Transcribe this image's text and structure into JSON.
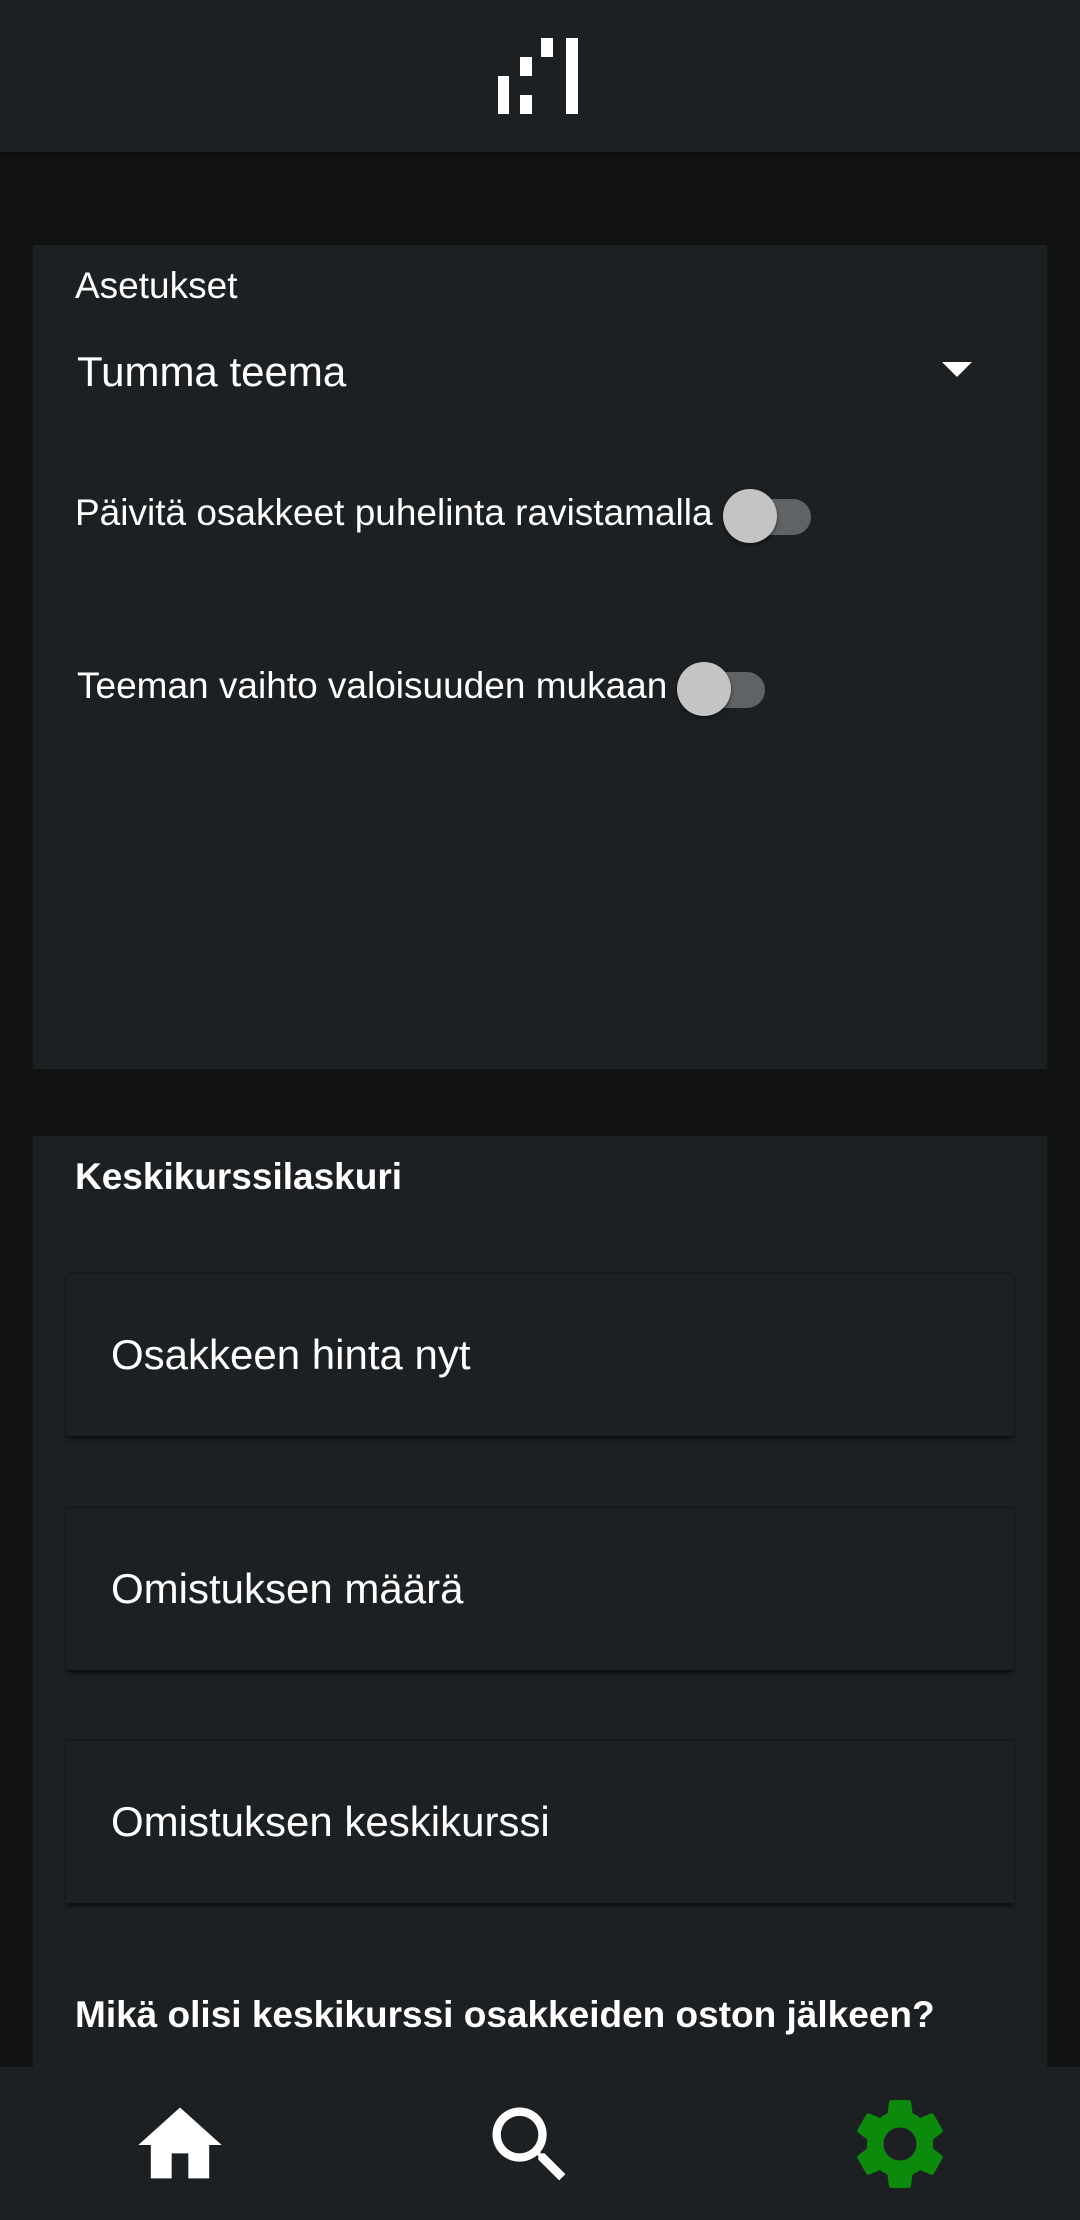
{
  "settings": {
    "title": "Asetukset",
    "theme_dropdown": {
      "selected": "Tumma teema"
    },
    "shake_refresh": {
      "label": "Päivitä osakkeet puhelinta ravistamalla",
      "on": false
    },
    "light_theme_switch": {
      "label": "Teeman vaihto valoisuuden mukaan",
      "on": false
    }
  },
  "calculator": {
    "title": "Keskikurssilaskuri",
    "fields": [
      {
        "placeholder": "Osakkeen hinta nyt",
        "value": ""
      },
      {
        "placeholder": "Omistuksen määrä",
        "value": ""
      },
      {
        "placeholder": "Omistuksen keskikurssi",
        "value": ""
      }
    ],
    "question": "Mikä olisi keskikurssi osakkeiden oston jälkeen?"
  },
  "nav": {
    "items": [
      {
        "icon": "home-icon",
        "active": false
      },
      {
        "icon": "search-icon",
        "active": false
      },
      {
        "icon": "gear-icon",
        "active": true
      }
    ],
    "active_color": "#0b8a0b",
    "inactive_color": "#ffffff"
  },
  "colors": {
    "background": "#121313",
    "surface": "#1c2023",
    "switch_track": "#5f6365",
    "switch_thumb": "#c4c4c4"
  }
}
